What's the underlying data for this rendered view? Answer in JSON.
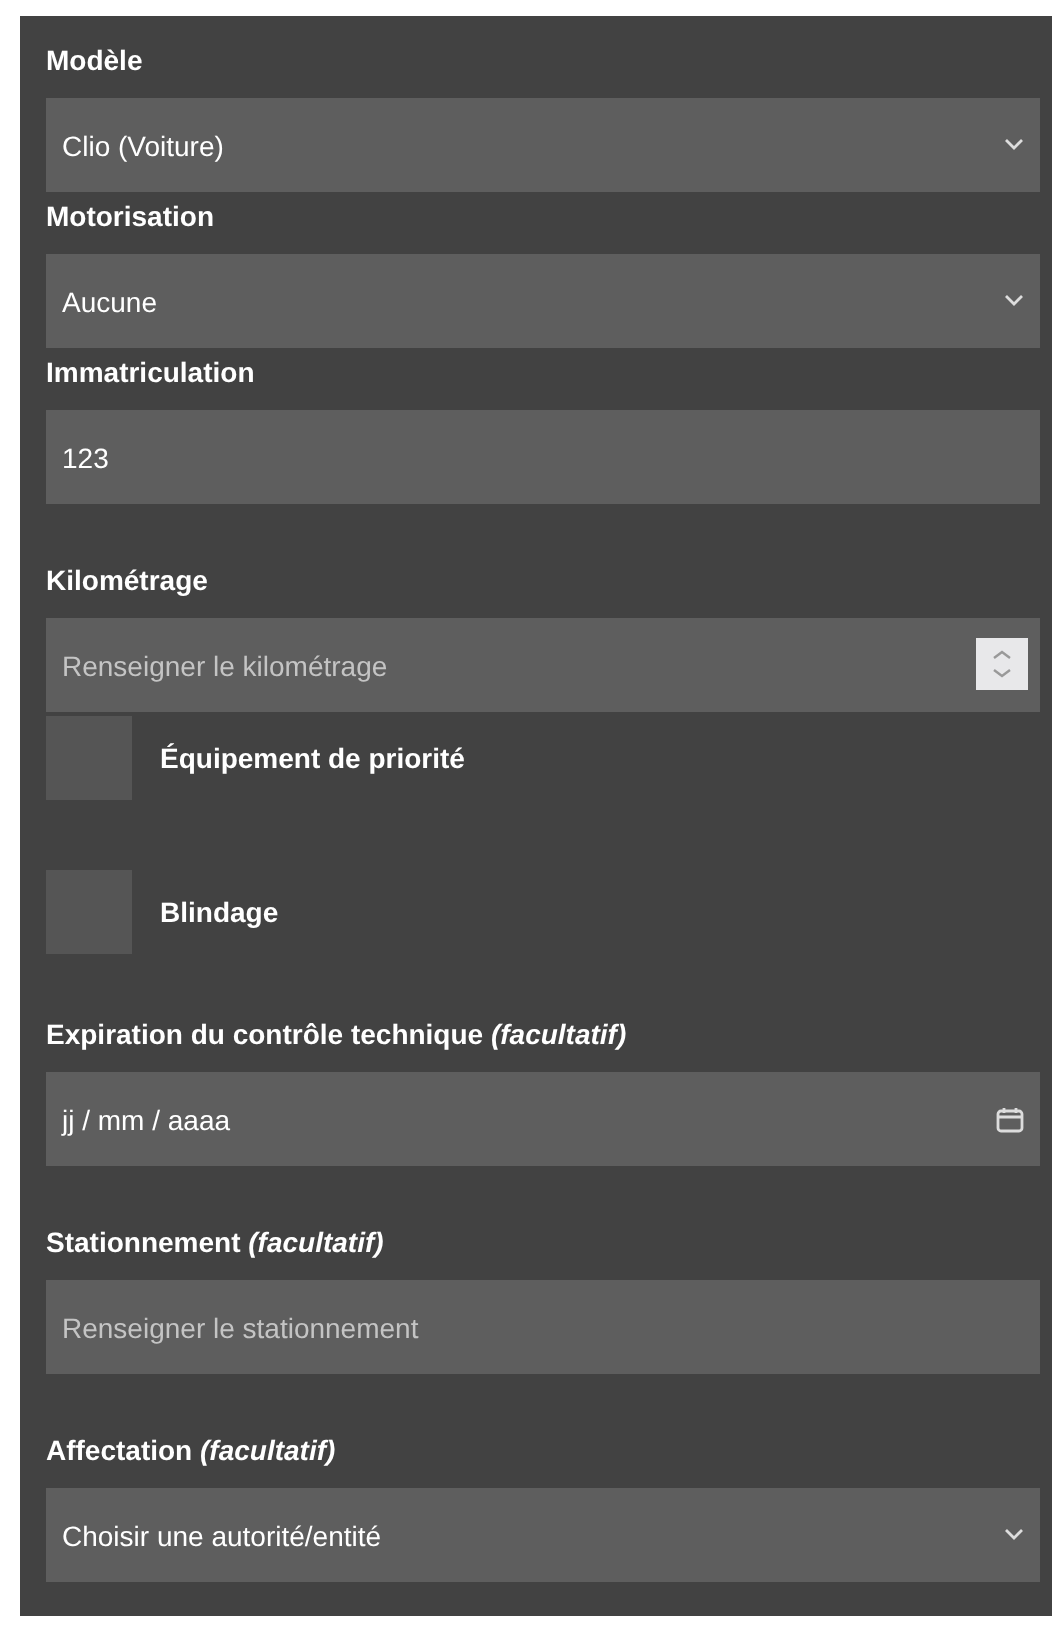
{
  "fields": [
    {
      "kind": "select",
      "label": "Modèle",
      "value": "Clio (Voiture)"
    },
    {
      "kind": "select",
      "label": "Motorisation",
      "value": "Aucune"
    },
    {
      "kind": "text",
      "label": "Immatriculation",
      "value": "123"
    },
    {
      "kind": "number",
      "label": "Kilométrage",
      "placeholder": "Renseigner le kilométrage"
    },
    {
      "kind": "checkbox",
      "label": "Équipement de priorité",
      "checked": false
    },
    {
      "kind": "checkbox",
      "label": "Blindage",
      "checked": false
    },
    {
      "kind": "date",
      "label": "Expiration du contrôle technique *(facultatif)*",
      "value": "jj / mm / aaaa"
    },
    {
      "kind": "text",
      "label": "Stationnement *(facultatif)*",
      "placeholder": "Renseigner le stationnement"
    },
    {
      "kind": "select",
      "label": "Affectation *(facultatif)*",
      "value": "Choisir une autorité/entité"
    }
  ]
}
